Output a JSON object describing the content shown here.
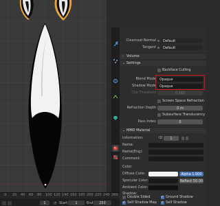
{
  "colors": {
    "viewport_bg": "#393939",
    "panel_bg": "#2d2d2d",
    "accent": "#4772b3",
    "highlight_box": "#d01818",
    "alpha_field": "#4772b3"
  },
  "icons": [
    "wrench-icon",
    "particles-icon",
    "physics-icon",
    "constraints-icon",
    "data-icon",
    "material-icon",
    "texture-icon"
  ],
  "props": {
    "clearcoat_normal": {
      "label": "Clearcoat Normal",
      "value": "Default"
    },
    "tangent": {
      "label": "Tangent",
      "value": "Default"
    },
    "volume_section": "Volume",
    "settings_section": "Settings",
    "backface_culling": "Backface Culling",
    "blend_mode": {
      "label": "Blend Mode",
      "value": "Opaque"
    },
    "shadow_mode": {
      "label": "Shadow Mode",
      "value": "Opaque"
    },
    "clip_threshold": {
      "label": "Clip Threshold",
      "value": "0.500"
    },
    "screen_space_refraction": "Screen Space Refraction",
    "refraction_depth": {
      "label": "Refraction Depth",
      "value": "0 m"
    },
    "subsurface_translucency": "Subsurface Translucency",
    "pass_index": {
      "label": "Pass Index",
      "value": "0"
    },
    "mmd_section": "MMD Material",
    "information": {
      "label": "Information:",
      "value": "ID",
      "value2": "1"
    },
    "name": "Name:",
    "name_eng": "Name(Eng):",
    "comment": "Comment:",
    "color_label": "Color:",
    "diffuse_color": "Diffuse Color:",
    "specular_color": "Specular Color:",
    "ambient_color": "Ambient Color:",
    "alpha": {
      "label": "Alpha",
      "value": "1.000"
    },
    "reflect": {
      "label": "Reflect",
      "value": "50.00"
    },
    "shadow_label": "Shadow:",
    "double_sided": "Double Sided",
    "ground_shadow": "Ground Shadow",
    "self_shadow_map": "Self Shadow Map",
    "self_shadow": "Self Shadow"
  },
  "timeline": {
    "ruler": [
      "0",
      "20",
      "40",
      "60",
      "80",
      "100",
      "120",
      "140",
      "160",
      "180",
      "200",
      "220",
      "240",
      "260"
    ],
    "current_frame": "1",
    "start_label": "Start",
    "start_value": "1",
    "end_label": "End",
    "end_value": "250"
  }
}
